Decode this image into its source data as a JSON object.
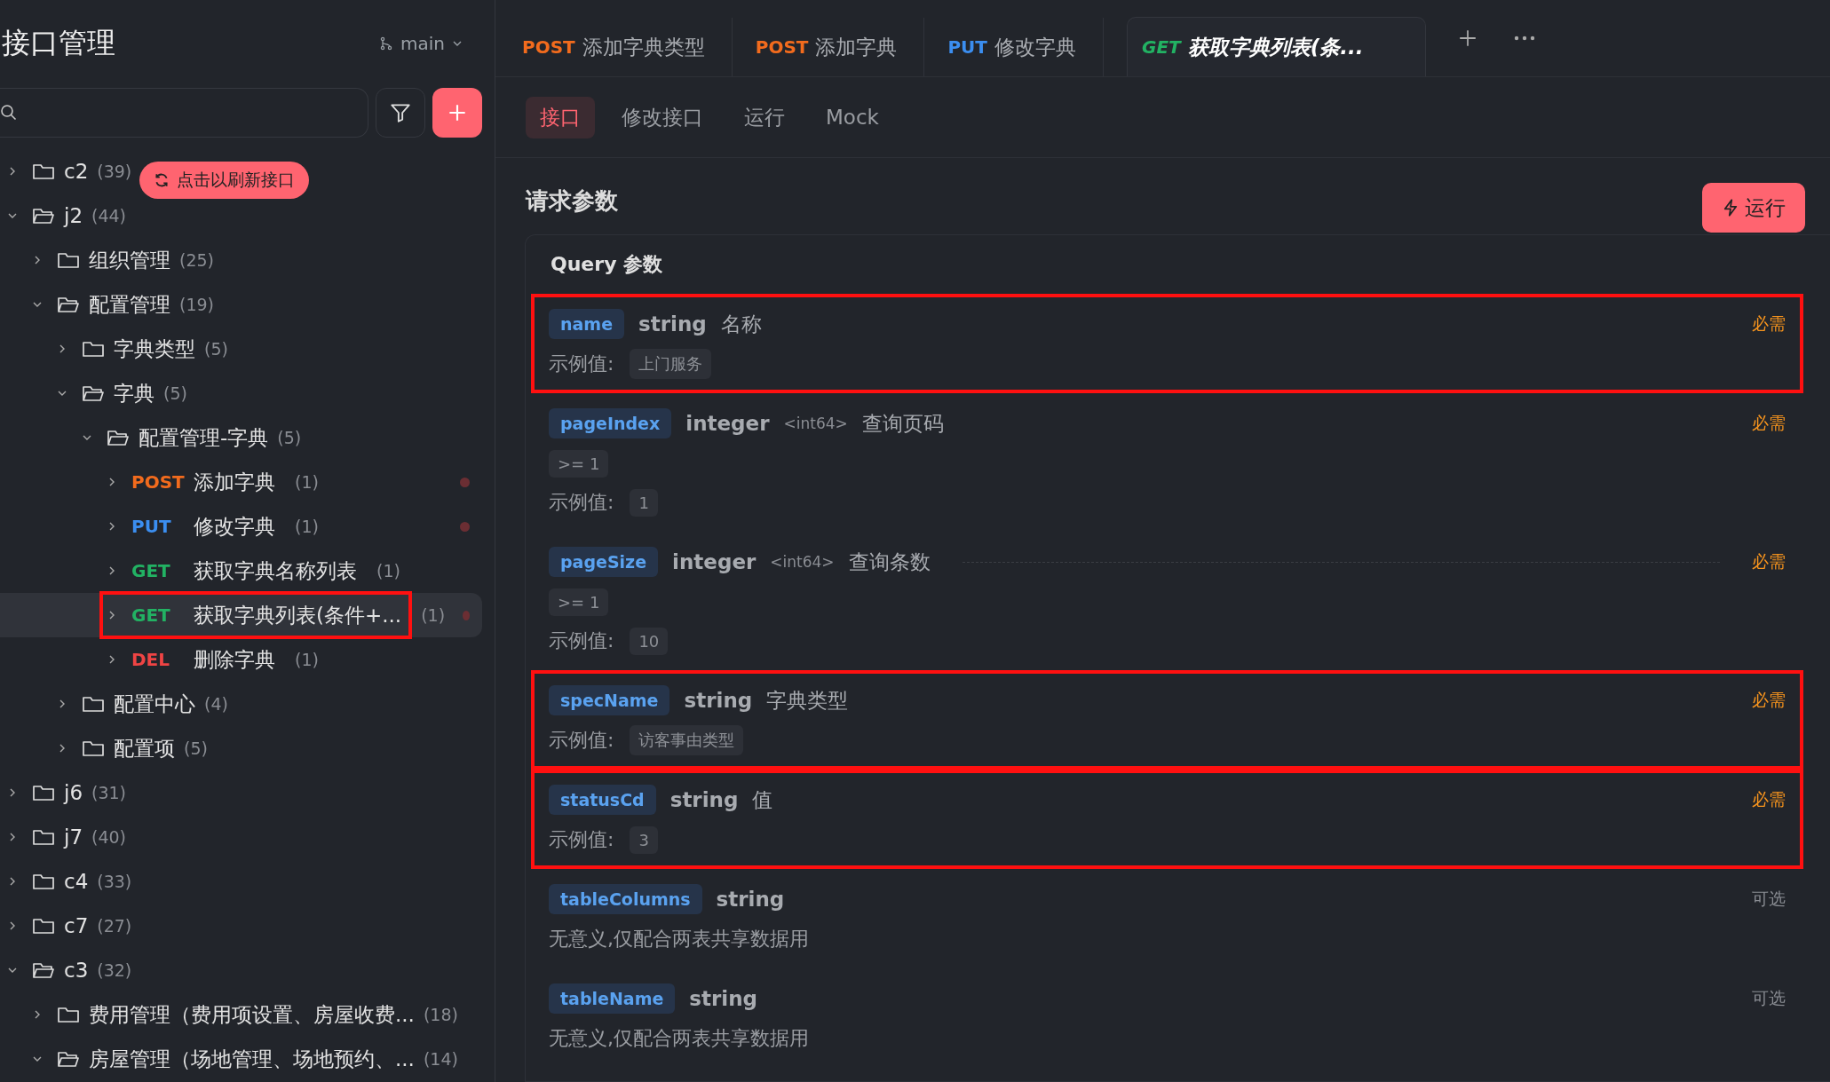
{
  "sidebar": {
    "title": "接口管理",
    "branch": "main",
    "refresh_button": "点击以刷新接口",
    "tree": [
      {
        "kind": "folder",
        "name": "c2",
        "count": "(39)",
        "expanded": false
      },
      {
        "kind": "folder",
        "name": "j2",
        "count": "(44)",
        "expanded": true,
        "children": [
          {
            "kind": "folder",
            "name": "组织管理",
            "count": "(25)",
            "expanded": false
          },
          {
            "kind": "folder",
            "name": "配置管理",
            "count": "(19)",
            "expanded": true,
            "children": [
              {
                "kind": "folder",
                "name": "字典类型",
                "count": "(5)",
                "expanded": false
              },
              {
                "kind": "folder",
                "name": "字典",
                "count": "(5)",
                "expanded": true,
                "children": [
                  {
                    "kind": "folder",
                    "name": "配置管理-字典",
                    "count": "(5)",
                    "expanded": true,
                    "children": [
                      {
                        "kind": "api",
                        "method": "POST",
                        "color": "#f26b1d",
                        "name": "添加字典",
                        "count": "(1)",
                        "expanded": false,
                        "selected": false,
                        "marked": true,
                        "highlighted": false
                      },
                      {
                        "kind": "api",
                        "method": "PUT",
                        "color": "#3b8ef0",
                        "name": "修改字典",
                        "count": "(1)",
                        "expanded": false,
                        "selected": false,
                        "marked": true,
                        "highlighted": false
                      },
                      {
                        "kind": "api",
                        "method": "GET",
                        "color": "#22b263",
                        "name": "获取字典名称列表",
                        "count": "(1)",
                        "expanded": false,
                        "selected": false,
                        "marked": false,
                        "highlighted": false
                      },
                      {
                        "kind": "api",
                        "method": "GET",
                        "color": "#22b263",
                        "name": "获取字典列表(条件+...",
                        "count": "(1)",
                        "expanded": false,
                        "selected": true,
                        "marked": true,
                        "highlighted": true
                      },
                      {
                        "kind": "api",
                        "method": "DEL",
                        "color": "#ef4444",
                        "name": "删除字典",
                        "count": "(1)",
                        "expanded": false,
                        "selected": false,
                        "marked": false,
                        "highlighted": false
                      }
                    ]
                  }
                ]
              },
              {
                "kind": "folder",
                "name": "配置中心",
                "count": "(4)",
                "expanded": false
              },
              {
                "kind": "folder",
                "name": "配置项",
                "count": "(5)",
                "expanded": false
              }
            ]
          }
        ]
      },
      {
        "kind": "folder",
        "name": "j6",
        "count": "(31)",
        "expanded": false
      },
      {
        "kind": "folder",
        "name": "j7",
        "count": "(40)",
        "expanded": false
      },
      {
        "kind": "folder",
        "name": "c4",
        "count": "(33)",
        "expanded": false
      },
      {
        "kind": "folder",
        "name": "c7",
        "count": "(27)",
        "expanded": false
      },
      {
        "kind": "folder",
        "name": "c3",
        "count": "(32)",
        "expanded": true,
        "children": [
          {
            "kind": "folder",
            "name": "费用管理（费用项设置、房屋收费...",
            "count": "(18)",
            "expanded": false
          },
          {
            "kind": "folder",
            "name": "房屋管理（场地管理、场地预约、...",
            "count": "(14)",
            "expanded": true
          }
        ]
      }
    ]
  },
  "tabs": [
    {
      "method": "POST",
      "color": "#f26b1d",
      "title": "添加字典类型",
      "selected": false
    },
    {
      "method": "POST",
      "color": "#f26b1d",
      "title": "添加字典",
      "selected": false
    },
    {
      "method": "PUT",
      "color": "#3b8ef0",
      "title": "修改字典",
      "selected": false
    },
    {
      "method": "GET",
      "color": "#22b263",
      "title": "获取字典列表(条...",
      "selected": true
    }
  ],
  "sub_tabs": [
    {
      "label": "接口",
      "selected": true
    },
    {
      "label": "修改接口",
      "selected": false
    },
    {
      "label": "运行",
      "selected": false
    },
    {
      "label": "Mock",
      "selected": false
    }
  ],
  "section_title": "请求参数",
  "run_button": "运行",
  "query_panel": {
    "title": "Query 参数",
    "params": [
      {
        "name": "name",
        "type": "string",
        "description": "名称",
        "requirement": "必需",
        "required": true,
        "example_label": "示例值:",
        "example": "上门服务",
        "highlighted": true,
        "hovered": false
      },
      {
        "name": "pageIndex",
        "type": "integer",
        "format": "<int64>",
        "description": "查询页码",
        "requirement": "必需",
        "required": true,
        "constraint": ">= 1",
        "example_label": "示例值:",
        "example": "1",
        "highlighted": false,
        "hovered": false
      },
      {
        "name": "pageSize",
        "type": "integer",
        "format": "<int64>",
        "description": "查询条数",
        "requirement": "必需",
        "required": true,
        "constraint": ">= 1",
        "example_label": "示例值:",
        "example": "10",
        "highlighted": false,
        "hovered": true
      },
      {
        "name": "specName",
        "type": "string",
        "description": "字典类型",
        "requirement": "必需",
        "required": true,
        "example_label": "示例值:",
        "example": "访客事由类型",
        "highlighted": true,
        "hovered": false
      },
      {
        "name": "statusCd",
        "type": "string",
        "description": "值",
        "requirement": "必需",
        "required": true,
        "example_label": "示例值:",
        "example": "3",
        "highlighted": true,
        "hovered": false
      },
      {
        "name": "tableColumns",
        "type": "string",
        "requirement": "可选",
        "required": false,
        "note": "无意义,仅配合两表共享数据用",
        "highlighted": false,
        "hovered": false
      },
      {
        "name": "tableName",
        "type": "string",
        "requirement": "可选",
        "required": false,
        "note": "无意义,仅配合两表共享数据用",
        "highlighted": false,
        "hovered": false
      }
    ]
  }
}
